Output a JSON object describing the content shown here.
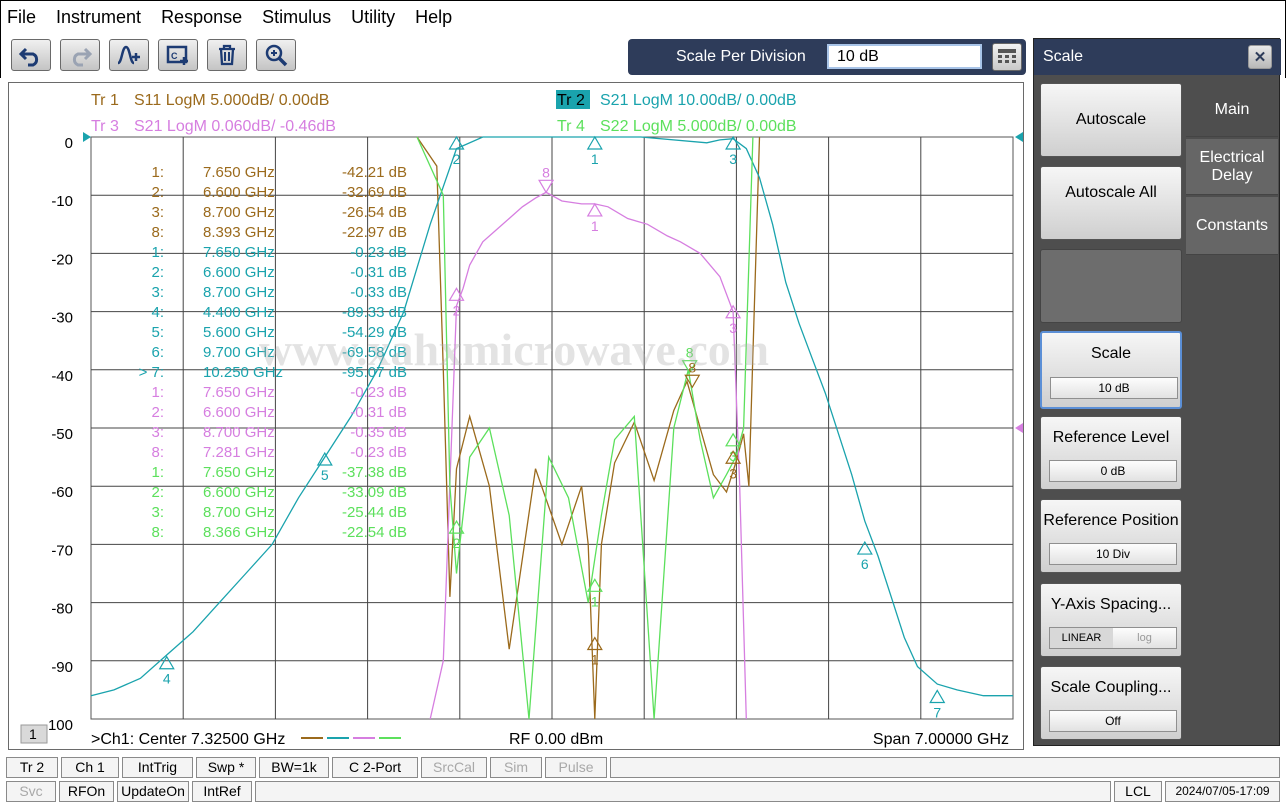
{
  "menu": [
    "File",
    "Instrument",
    "Response",
    "Stimulus",
    "Utility",
    "Help"
  ],
  "toolbar_icons": [
    "undo-icon",
    "redo-icon",
    "add-trace-icon",
    "channel-icon",
    "delete-icon",
    "zoom-icon"
  ],
  "entry": {
    "label": "Scale Per Division",
    "value": "10 dB"
  },
  "trace_headers": [
    {
      "tag": "Tr  1",
      "desc": "S11 LogM 5.000dB/  0.00dB",
      "color": "#9b6a1c"
    },
    {
      "tag": "Tr  2",
      "desc": "S21 LogM 10.00dB/  0.00dB",
      "color": "#1aa3ad"
    },
    {
      "tag": "Tr  3",
      "desc": "S21 LogM 0.060dB/  -0.46dB",
      "color": "#d67ee0"
    },
    {
      "tag": "Tr  4",
      "desc": "S22 LogM 5.000dB/  0.00dB",
      "color": "#5ce05c"
    }
  ],
  "markers": [
    {
      "n": "1:",
      "f": "7.650  GHz",
      "v": "-42.21 dB",
      "c": "#9b6a1c"
    },
    {
      "n": "2:",
      "f": "6.600  GHz",
      "v": "-32.69 dB",
      "c": "#9b6a1c"
    },
    {
      "n": "3:",
      "f": "8.700  GHz",
      "v": "-26.54 dB",
      "c": "#9b6a1c"
    },
    {
      "n": "8:",
      "f": "8.393  GHz",
      "v": "-22.97 dB",
      "c": "#9b6a1c"
    },
    {
      "n": "1:",
      "f": "7.650  GHz",
      "v": "-0.23 dB",
      "c": "#1aa3ad"
    },
    {
      "n": "2:",
      "f": "6.600  GHz",
      "v": "-0.31 dB",
      "c": "#1aa3ad"
    },
    {
      "n": "3:",
      "f": "8.700  GHz",
      "v": "-0.33 dB",
      "c": "#1aa3ad"
    },
    {
      "n": "4:",
      "f": "4.400  GHz",
      "v": "-89.33 dB",
      "c": "#1aa3ad"
    },
    {
      "n": "5:",
      "f": "5.600  GHz",
      "v": "-54.29 dB",
      "c": "#1aa3ad"
    },
    {
      "n": "6:",
      "f": "9.700  GHz",
      "v": "-69.58 dB",
      "c": "#1aa3ad"
    },
    {
      "n": "> 7:",
      "f": "10.250  GHz",
      "v": "-95.07 dB",
      "c": "#1aa3ad"
    },
    {
      "n": "1:",
      "f": "7.650  GHz",
      "v": "-0.23 dB",
      "c": "#d67ee0"
    },
    {
      "n": "2:",
      "f": "6.600  GHz",
      "v": "-0.31 dB",
      "c": "#d67ee0"
    },
    {
      "n": "3:",
      "f": "8.700  GHz",
      "v": "-0.35 dB",
      "c": "#d67ee0"
    },
    {
      "n": "8:",
      "f": "7.281  GHz",
      "v": "-0.23 dB",
      "c": "#d67ee0"
    },
    {
      "n": "1:",
      "f": "7.650  GHz",
      "v": "-37.38 dB",
      "c": "#5ce05c"
    },
    {
      "n": "2:",
      "f": "6.600  GHz",
      "v": "-33.09 dB",
      "c": "#5ce05c"
    },
    {
      "n": "3:",
      "f": "8.700  GHz",
      "v": "-25.44 dB",
      "c": "#5ce05c"
    },
    {
      "n": "8:",
      "f": "8.366  GHz",
      "v": "-22.54 dB",
      "c": "#5ce05c"
    }
  ],
  "watermark": "www.xahxmicrowave.com",
  "plot_footer": {
    "channel_box": "1",
    "center": ">Ch1:  Center  7.32500 GHz",
    "rf": "RF    0.00 dBm",
    "span": "Span  7.00000 GHz"
  },
  "chart_data": {
    "type": "line",
    "x_range_ghz": [
      3.825,
      10.825
    ],
    "ylim": [
      -100,
      0
    ],
    "ytick_labels": [
      "0",
      "-10",
      "-20",
      "-30",
      "-40",
      "-50",
      "-60",
      "-70",
      "-80",
      "-90",
      "-100"
    ],
    "grid": true,
    "series": [
      {
        "name": "S11",
        "color": "#9b6a1c",
        "x": [
          6.3,
          6.45,
          6.5,
          6.55,
          6.6,
          6.7,
          6.85,
          7.0,
          7.2,
          7.4,
          7.55,
          7.6,
          7.65,
          7.7,
          7.8,
          7.95,
          8.1,
          8.25,
          8.35,
          8.45,
          8.55,
          8.65,
          8.72,
          8.78,
          8.82,
          8.9
        ],
        "y": [
          0,
          -5,
          -40,
          -79,
          -57,
          -48,
          -60,
          -88,
          -57,
          -70,
          -60,
          -70,
          -100,
          -70,
          -56,
          -49,
          -59,
          -47,
          -42,
          -50,
          -58,
          -61,
          -56,
          -51,
          -60,
          0
        ]
      },
      {
        "name": "S21",
        "color": "#1aa3ad",
        "x": [
          3.825,
          4.0,
          4.2,
          4.4,
          4.6,
          4.8,
          5.0,
          5.2,
          5.4,
          5.6,
          5.8,
          6.0,
          6.2,
          6.4,
          6.6,
          6.8,
          7.0,
          7.5,
          8.0,
          8.5,
          8.6,
          8.7,
          8.8,
          8.9,
          9.0,
          9.1,
          9.2,
          9.3,
          9.4,
          9.5,
          9.6,
          9.7,
          9.8,
          9.9,
          10.0,
          10.1,
          10.25,
          10.4,
          10.6,
          10.825
        ],
        "y": [
          -96,
          -95,
          -93,
          -89,
          -85,
          -80,
          -75,
          -70,
          -62,
          -55,
          -48,
          -40,
          -30,
          -15,
          -2,
          0,
          0,
          0,
          0,
          -1,
          -0.5,
          -0.3,
          -2,
          -7,
          -15,
          -25,
          -32,
          -38,
          -44,
          -51,
          -58,
          -66,
          -72,
          -79,
          -86,
          -91,
          -94,
          -95,
          -96,
          -96
        ]
      },
      {
        "name": "S21",
        "color": "#d67ee0",
        "x": [
          6.4,
          6.5,
          6.6,
          6.65,
          6.7,
          6.8,
          6.9,
          7.0,
          7.1,
          7.2,
          7.28,
          7.4,
          7.55,
          7.65,
          7.75,
          7.9,
          8.05,
          8.2,
          8.3,
          8.45,
          8.6,
          8.7,
          8.75,
          8.8
        ],
        "y": [
          -100,
          -90,
          -29,
          -26,
          -22,
          -18,
          -16,
          -14,
          -12,
          -10.5,
          -9.5,
          -11,
          -11.5,
          -11.5,
          -12,
          -14,
          -15,
          -17,
          -18,
          -20,
          -24,
          -30,
          -60,
          -100
        ]
      },
      {
        "name": "S22",
        "color": "#5ce05c",
        "x": [
          6.3,
          6.5,
          6.55,
          6.6,
          6.7,
          6.85,
          7.0,
          7.15,
          7.3,
          7.45,
          7.6,
          7.7,
          7.8,
          7.95,
          8.1,
          8.25,
          8.36,
          8.45,
          8.55,
          8.65,
          8.72,
          8.78,
          8.85
        ],
        "y": [
          0,
          -10,
          -60,
          -75,
          -55,
          -50,
          -65,
          -100,
          -55,
          -62,
          -80,
          -65,
          -52,
          -48,
          -100,
          -50,
          -40,
          -52,
          -62,
          -58,
          -55,
          -50,
          0
        ]
      }
    ]
  },
  "panel": {
    "title": "Scale",
    "buttons": [
      {
        "label": "Autoscale"
      },
      {
        "label": "Autoscale All"
      },
      {
        "label": ""
      },
      {
        "label": "Scale",
        "value": "10 dB"
      },
      {
        "label": "Reference Level",
        "value": "0 dB"
      },
      {
        "label": "Reference Position",
        "value": "10 Div"
      },
      {
        "label": "Y-Axis Spacing...",
        "opt_a": "LINEAR",
        "opt_b": "log"
      },
      {
        "label": "Scale Coupling...",
        "value": "Off"
      }
    ],
    "tabs": [
      "Main",
      "Electrical Delay",
      "Constants"
    ]
  },
  "status_row1": [
    "Tr 2",
    "Ch 1",
    "IntTrig",
    "Swp *",
    "BW=1k",
    "C  2-Port",
    "SrcCal",
    "Sim",
    "Pulse"
  ],
  "status_row2": [
    "Svc",
    "RFOn",
    "UpdateOn",
    "IntRef",
    "LCL",
    "2024/07/05-17:09"
  ]
}
